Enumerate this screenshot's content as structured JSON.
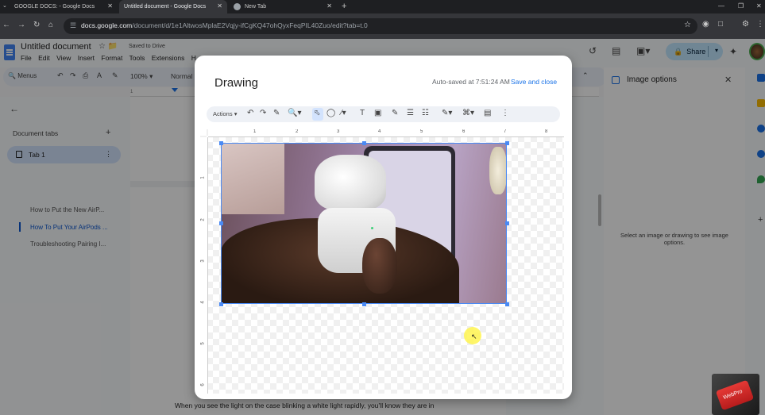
{
  "browser": {
    "tabs": [
      {
        "title": "GOOGLE DOCS: - Google Docs",
        "active": false
      },
      {
        "title": "Untitled document - Google Docs",
        "active": true
      },
      {
        "title": "New Tab",
        "active": false
      }
    ],
    "url_host": "docs.google.com",
    "url_path": "/document/d/1e1AltwosMplaE2Vqjy-ifCgKQ47ohQyxFeqPIL40Zuo/edit?tab=t.0"
  },
  "docs": {
    "title": "Untitled document",
    "saved_status": "Saved to Drive",
    "menu": [
      "File",
      "Edit",
      "View",
      "Insert",
      "Format",
      "Tools",
      "Extensions",
      "H"
    ],
    "share_label": "Share",
    "toolbar": {
      "menus_label": "Menus",
      "zoom": "100%",
      "style": "Normal te"
    },
    "left_pane": {
      "header": "Document tabs",
      "tab": "Tab 1",
      "outline": [
        "How to Put the New AirP...",
        "How To Put Your AirPods ...",
        "Troubleshooting Pairing I..."
      ]
    },
    "body_text": "When you see the light on the case blinking a white light rapidly, you’ll know they are in",
    "ruler_marks": [
      "1"
    ]
  },
  "image_options": {
    "title": "Image options",
    "message": "Select an image or drawing to see image options."
  },
  "drawing": {
    "title": "Drawing",
    "autosave": "Auto-saved at 7:51:24 AM",
    "save_close": "Save and close",
    "actions_label": "Actions",
    "h_ruler": [
      "1",
      "2",
      "3",
      "4",
      "5",
      "6",
      "7",
      "8"
    ],
    "v_ruler": [
      "1",
      "2",
      "3",
      "4",
      "5",
      "6"
    ]
  },
  "watermark": "WebPro"
}
